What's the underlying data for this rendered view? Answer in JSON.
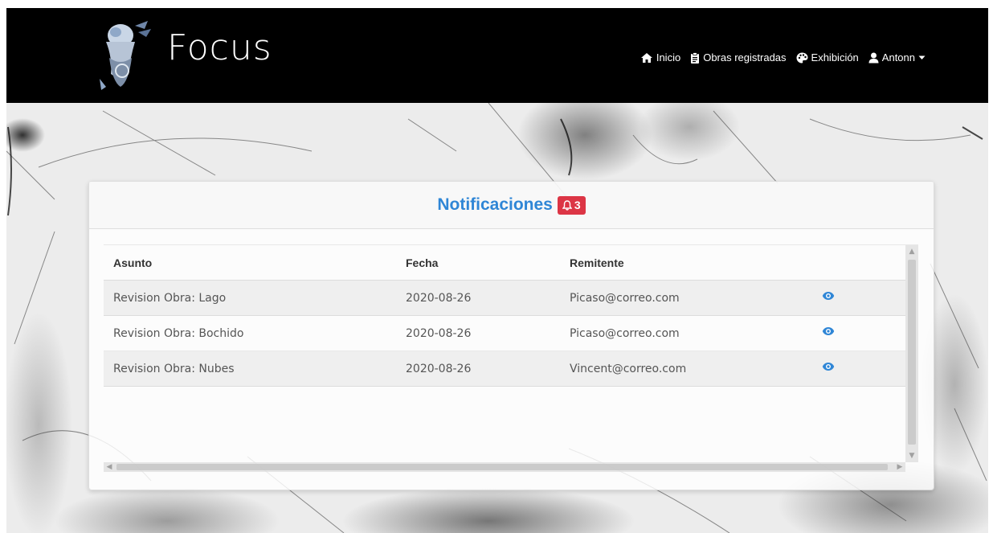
{
  "brand": {
    "name": "Focus",
    "logo_icon": "angel-statue-logo"
  },
  "nav": {
    "items": [
      {
        "label": "Inicio",
        "icon": "home-icon"
      },
      {
        "label": "Obras registradas",
        "icon": "clipboard-icon"
      },
      {
        "label": "Exhibición",
        "icon": "palette-icon"
      },
      {
        "label": "Antonn",
        "icon": "user-icon",
        "dropdown": true
      }
    ]
  },
  "notifications": {
    "title": "Notificaciones",
    "count": "3",
    "bell_icon": "bell-icon",
    "columns": [
      "Asunto",
      "Fecha",
      "Remitente"
    ],
    "rows": [
      {
        "asunto": "Revision Obra: Lago",
        "fecha": "2020-08-26",
        "remitente": "Picaso@correo.com"
      },
      {
        "asunto": "Revision Obra: Bochido",
        "fecha": "2020-08-26",
        "remitente": "Picaso@correo.com"
      },
      {
        "asunto": "Revision Obra: Nubes",
        "fecha": "2020-08-26",
        "remitente": "Vincent@correo.com"
      }
    ],
    "view_icon": "eye-icon"
  },
  "colors": {
    "navbar": "#000000",
    "accent": "#2f86d6",
    "badge": "#dc3545"
  }
}
